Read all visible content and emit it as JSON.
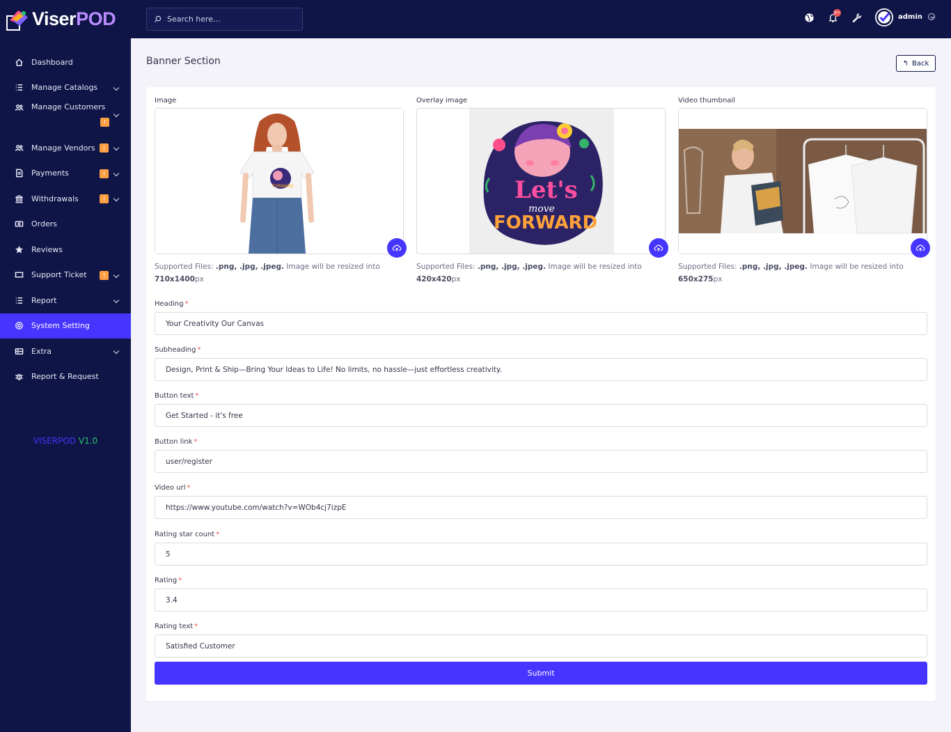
{
  "brand": {
    "name_part1": "Viser",
    "name_part2": "POD"
  },
  "search": {
    "placeholder": "Search here..."
  },
  "sidebar": {
    "items": [
      {
        "label": "Dashboard",
        "icon": "home-icon"
      },
      {
        "label": "Manage Catalogs",
        "icon": "list-icon"
      },
      {
        "label": "Manage Customers",
        "icon": "users-icon",
        "badge": "!"
      },
      {
        "label": "Manage Vendors",
        "icon": "users-icon",
        "badge": "!"
      },
      {
        "label": "Payments",
        "icon": "file-icon",
        "badge": "!"
      },
      {
        "label": "Withdrawals",
        "icon": "bank-icon",
        "badge": "!"
      },
      {
        "label": "Orders",
        "icon": "money-icon"
      },
      {
        "label": "Reviews",
        "icon": "star-icon"
      },
      {
        "label": "Support Ticket",
        "icon": "ticket-icon",
        "badge": "!"
      },
      {
        "label": "Report",
        "icon": "list-icon"
      },
      {
        "label": "System Setting",
        "icon": "gear-icon"
      },
      {
        "label": "Extra",
        "icon": "server-icon"
      },
      {
        "label": "Report & Request",
        "icon": "bug-icon"
      }
    ],
    "version_name": "VISERPOD",
    "version_number": "V1.0"
  },
  "topbar": {
    "notification_count": "9+",
    "user_name": "admin"
  },
  "page": {
    "title": "Banner Section",
    "back_label": "Back"
  },
  "images": [
    {
      "label": "Image",
      "help_prefix": "Supported Files: ",
      "formats": ".png, .jpg, .jpeg.",
      "help_middle": " Image will be resized into ",
      "size": "710x1400",
      "unit": "px"
    },
    {
      "label": "Overlay image",
      "help_prefix": "Supported Files: ",
      "formats": ".png, .jpg, .jpeg.",
      "help_middle": " Image will be resized into ",
      "size": "420x420",
      "unit": "px"
    },
    {
      "label": "Video thumbnail",
      "help_prefix": "Supported Files: ",
      "formats": ".png, .jpg, .jpeg.",
      "help_middle": " Image will be resized into ",
      "size": "650x275",
      "unit": "px"
    }
  ],
  "overlay_art": {
    "line1": "Let's",
    "line2": "move",
    "line3": "FORWARD"
  },
  "form": {
    "heading": {
      "label": "Heading",
      "value": "Your Creativity Our Canvas"
    },
    "subheading": {
      "label": "Subheading",
      "value": "Design, Print & Ship—Bring Your Ideas to Life! No limits, no hassle—just effortless creativity."
    },
    "button_text": {
      "label": "Button text",
      "value": "Get Started - it's free"
    },
    "button_link": {
      "label": "Button link",
      "value": "user/register"
    },
    "video_url": {
      "label": "Video url",
      "value": "https://www.youtube.com/watch?v=WOb4cj7izpE"
    },
    "rating_star_count": {
      "label": "Rating star count",
      "value": "5"
    },
    "rating": {
      "label": "Rating",
      "value": "3.4"
    },
    "rating_text": {
      "label": "Rating text",
      "value": "Satisfied Customer"
    },
    "required_mark": "*",
    "submit_label": "Submit"
  },
  "colors": {
    "sidebar_bg": "#0f1547",
    "accent": "#4634ff",
    "badge": "#ff9f43",
    "danger": "#ea5455"
  }
}
